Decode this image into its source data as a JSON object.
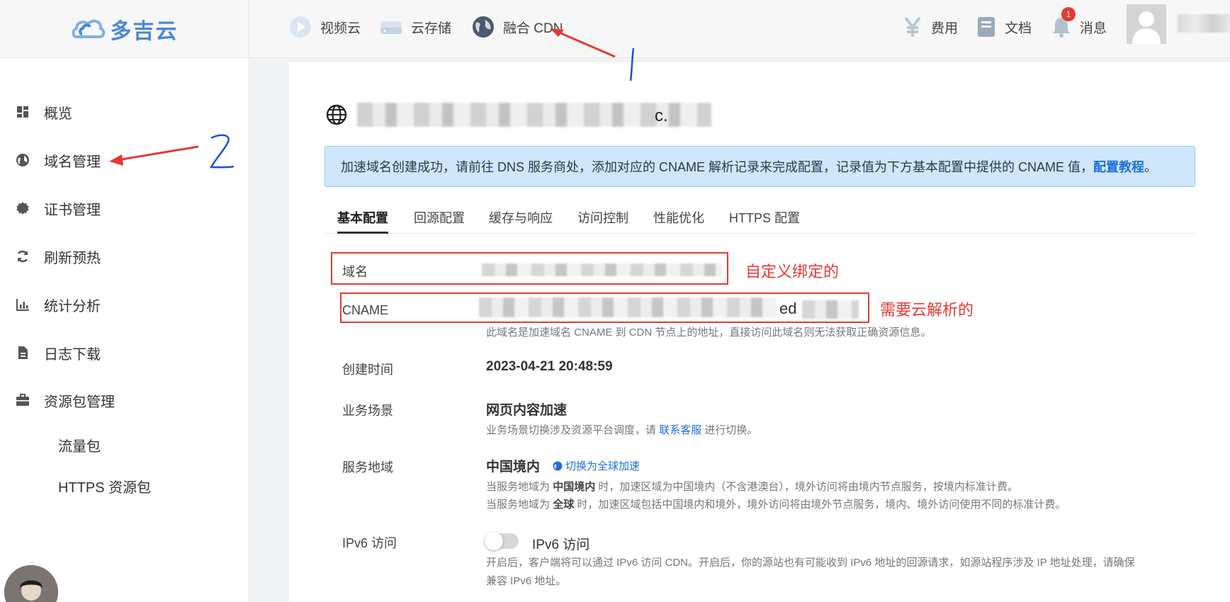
{
  "brand": {
    "name": "多吉云",
    "color": "#4a86d8"
  },
  "nav": {
    "items": [
      {
        "label": "视频云",
        "icon": "play-circle-icon"
      },
      {
        "label": "云存储",
        "icon": "storage-drive-icon"
      },
      {
        "label": "融合 CDN",
        "icon": "globe-icon"
      }
    ]
  },
  "header_right": {
    "billing": {
      "label": "费用",
      "icon": "yen-icon"
    },
    "docs": {
      "label": "文档",
      "icon": "book-icon"
    },
    "messages": {
      "label": "消息",
      "icon": "bell-icon",
      "badge": "1"
    }
  },
  "sidebar": {
    "items": [
      {
        "label": "概览",
        "icon": "dashboard-grid-icon"
      },
      {
        "label": "域名管理",
        "icon": "globe-icon"
      },
      {
        "label": "证书管理",
        "icon": "certificate-badge-icon"
      },
      {
        "label": "刷新预热",
        "icon": "refresh-icon"
      },
      {
        "label": "统计分析",
        "icon": "bar-chart-icon"
      },
      {
        "label": "日志下载",
        "icon": "document-icon"
      },
      {
        "label": "资源包管理",
        "icon": "briefcase-icon"
      }
    ],
    "sub_items": [
      {
        "label": "流量包"
      },
      {
        "label": "HTTPS 资源包"
      }
    ]
  },
  "domain_header": {
    "title_fragment": "c."
  },
  "notice": {
    "text": "加速域名创建成功，请前往 DNS 服务商处，添加对应的 CNAME 解析记录来完成配置，记录值为下方基本配置中提供的 CNAME 值，",
    "link": "配置教程",
    "end": "。"
  },
  "tabs": [
    {
      "label": "基本配置",
      "active": true
    },
    {
      "label": "回源配置"
    },
    {
      "label": "缓存与响应"
    },
    {
      "label": "访问控制"
    },
    {
      "label": "性能优化"
    },
    {
      "label": "HTTPS 配置"
    }
  ],
  "config": {
    "domain": {
      "label": "域名"
    },
    "cname": {
      "label": "CNAME",
      "value_fragment": "ed",
      "hint": "此域名是加速域名 CNAME 到 CDN 节点上的地址，直接访问此域名则无法获取正确资源信息。"
    },
    "created": {
      "label": "创建时间",
      "value": "2023-04-21 20:48:59"
    },
    "scene": {
      "label": "业务场景",
      "value": "网页内容加速",
      "hint_pre": "业务场景切换涉及资源平台调度，请",
      "hint_link": "联系客服",
      "hint_post": "进行切换。"
    },
    "region": {
      "label": "服务地域",
      "value": "中国境内",
      "switch_link": "切换为全球加速",
      "hint1_pre": "当服务地域为",
      "hint1_bold": "中国境内",
      "hint1_post": "时，加速区域为中国境内（不含港澳台），境外访问将由境内节点服务，按境内标准计费。",
      "hint2_pre": "当服务地域为",
      "hint2_bold": "全球",
      "hint2_post": "时，加速区域包括中国境内和境外，境外访问将由境外节点服务，境内、境外访问使用不同的标准计费。"
    },
    "ipv6": {
      "label": "IPv6 访问",
      "toggle_label": "IPv6 访问",
      "enabled": false,
      "hint1": "开启后，客户端将可以通过 IPv6 访问 CDN。开启后，你的源站也有可能收到 IPv6 地址的回源请求，如源站程序涉及 IP 地址处理，请确保",
      "hint2": "兼容 IPv6 地址。"
    }
  },
  "annotations": {
    "note_domain": "自定义绑定的",
    "note_cname": "需要云解析的",
    "mark_1": "1",
    "mark_2": "2",
    "color": "#e53935"
  }
}
